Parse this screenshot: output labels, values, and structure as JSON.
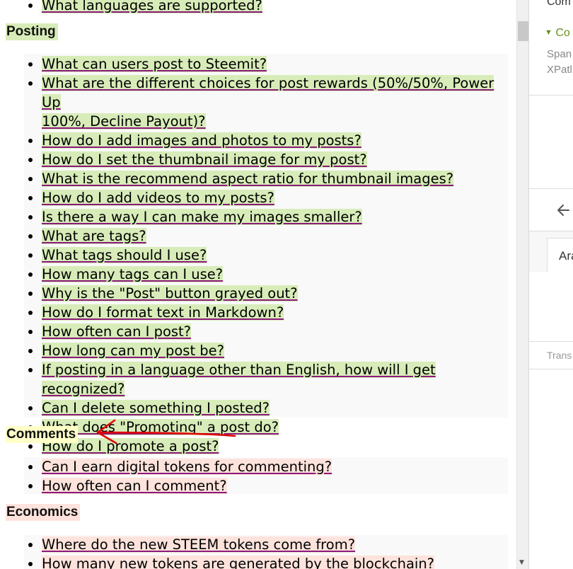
{
  "sections": {
    "top_item": "What languages are supported?",
    "posting": {
      "heading": "Posting",
      "items": [
        "What can users post to Steemit?",
        "What are the different choices for post rewards (50%/50%, Power Up",
        "100%, Decline Payout)?",
        "How do I add images and photos to my posts?",
        "How do I set the thumbnail image for my post?",
        "What is the recommend aspect ratio for thumbnail images?",
        "How do I add videos to my posts?",
        "Is there a way I can make my images smaller?",
        "What are tags?",
        "What tags should I use?",
        "How many tags can I use?",
        "Why is the \"Post\" button grayed out?",
        "How do I format text in Markdown?",
        "How often can I post?",
        "How long can my post be?",
        "If posting in a language other than English, how will I get recognized?",
        "Can I delete something I posted?",
        "What does \"Promoting\" a post do?",
        "How do I promote a post?"
      ]
    },
    "comments": {
      "heading": "Comments",
      "items": [
        "Can I earn digital tokens for commenting?",
        "How often can I comment?"
      ]
    },
    "economics": {
      "heading": "Economics",
      "items": [
        "Where do the new STEEM tokens come from?",
        "How many new tokens are generated by the blockchain?"
      ]
    }
  },
  "devtools": {
    "top_label": "Com",
    "section_label": "Co",
    "line1": "Span",
    "line2": "XPatl",
    "back_icon": "arrow-left-icon",
    "tab_label": "Ara",
    "footer_label": "Trans"
  },
  "colors": {
    "highlight_green": "#d8ecb9",
    "highlight_pink": "#fde3dc",
    "highlight_yellow": "#ffffc8",
    "underline": "#8b1a7a",
    "arrow": "#e00000",
    "triangle": "#7a9a1a"
  }
}
